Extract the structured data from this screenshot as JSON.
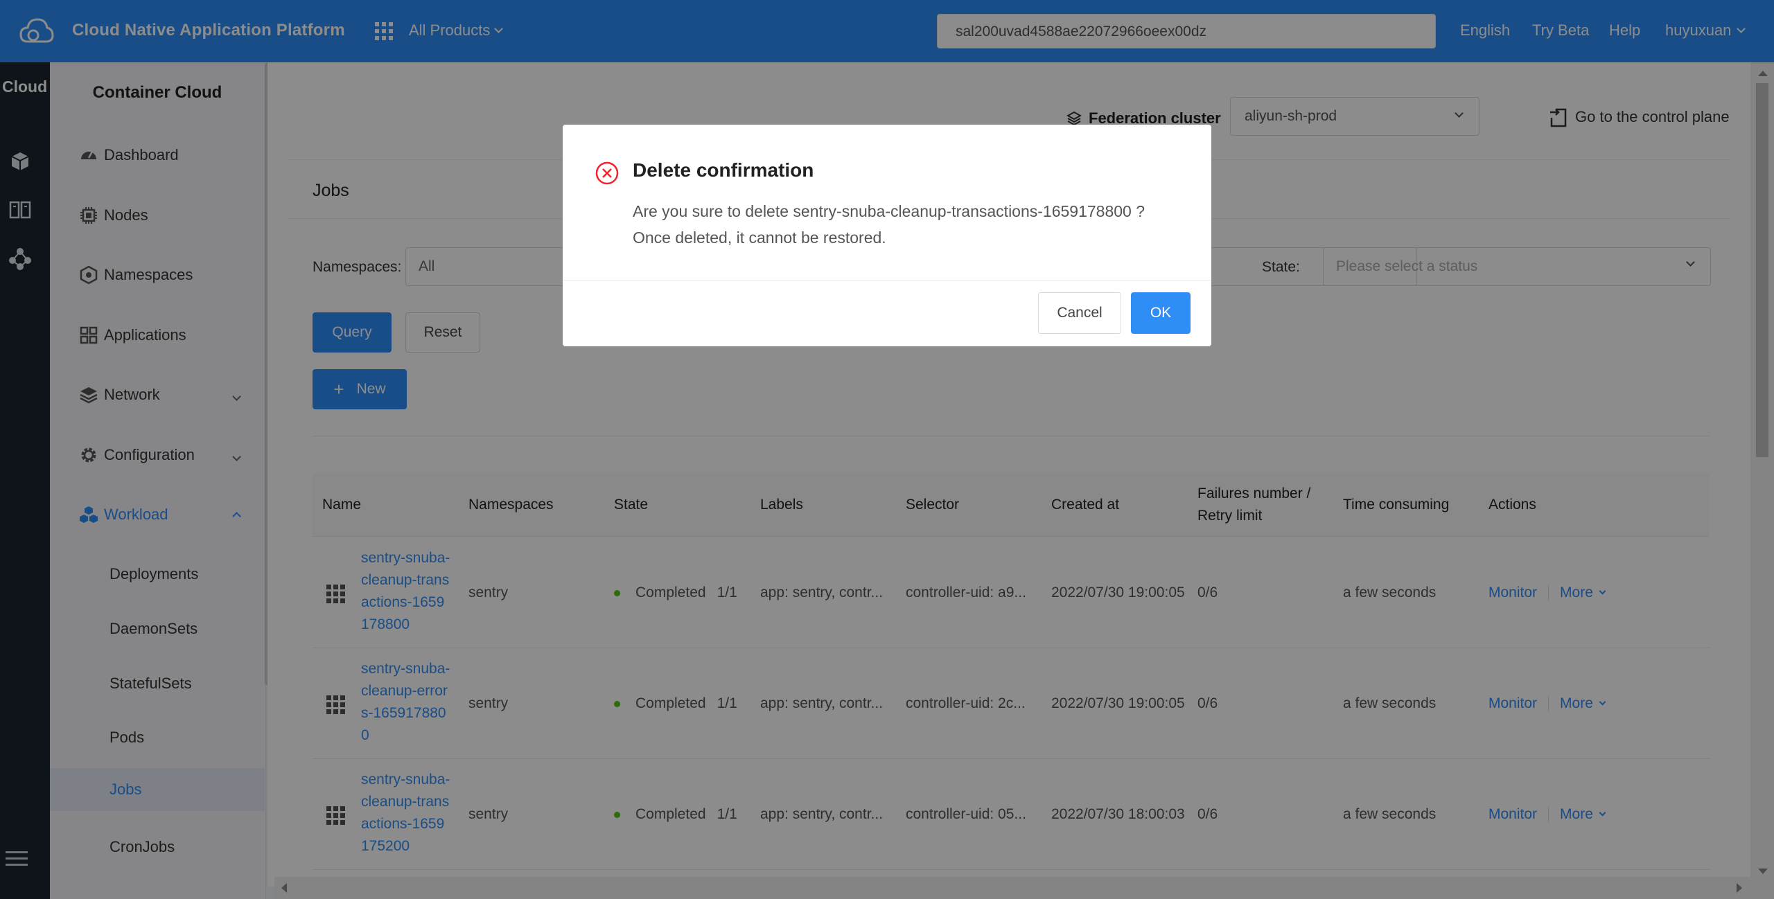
{
  "topbar": {
    "app_title": "Cloud Native Application Platform",
    "products_label": "All Products",
    "search_value": "sal200uvad4588ae22072966oeex00dz",
    "language": "English",
    "try_beta": "Try Beta",
    "help": "Help",
    "user": "huyuxuan",
    "bar_color": "#2f8df6"
  },
  "rail": {
    "title": "Cloud",
    "icons": [
      "cube-icon",
      "book-icon",
      "cluster-icon",
      "menu-icon"
    ]
  },
  "sidebar": {
    "header": "Container Cloud",
    "items": [
      {
        "label": "Dashboard",
        "icon": "dashboard-icon"
      },
      {
        "label": "Nodes",
        "icon": "chip-icon"
      },
      {
        "label": "Namespaces",
        "icon": "hexagon-icon"
      },
      {
        "label": "Applications",
        "icon": "apps-icon"
      },
      {
        "label": "Network",
        "icon": "layers-icon"
      },
      {
        "label": "Configuration",
        "icon": "gear-icon"
      },
      {
        "label": "Workload",
        "icon": "cubes-icon"
      }
    ],
    "workload_children": [
      "Deployments",
      "DaemonSets",
      "StatefulSets",
      "Pods",
      "Jobs",
      "CronJobs"
    ],
    "active_item": "Jobs"
  },
  "cluster": {
    "label": "Federation cluster",
    "selected": "aliyun-sh-prod",
    "control_plane": "Go to the control plane"
  },
  "jobs": {
    "title": "Jobs",
    "filters": {
      "namespaces_label": "Namespaces",
      "namespaces_value": "All",
      "state_label": "State",
      "state_placeholder": "Please select a status",
      "colon": ":"
    },
    "buttons": {
      "query": "Query",
      "reset": "Reset",
      "new": "New",
      "plus": "+"
    },
    "columns": [
      "Name",
      "Namespaces",
      "State",
      "Labels",
      "Selector",
      "Created at",
      "Failures number / Retry limit",
      "Time consuming",
      "Actions"
    ],
    "rows": [
      {
        "name": "sentry-snuba-cleanup-transactions-1659178800",
        "namespace": "sentry",
        "state": "Completed",
        "count": "1/1",
        "labels": "app: sentry, contr...",
        "selector": "controller-uid: a9...",
        "created": "2022/07/30 19:00:05",
        "failures": "0/6",
        "time": "a few seconds",
        "monitor": "Monitor",
        "more": "More"
      },
      {
        "name": "sentry-snuba-cleanup-errors-1659178800",
        "namespace": "sentry",
        "state": "Completed",
        "count": "1/1",
        "labels": "app: sentry, contr...",
        "selector": "controller-uid: 2c...",
        "created": "2022/07/30 19:00:05",
        "failures": "0/6",
        "time": "a few seconds",
        "monitor": "Monitor",
        "more": "More"
      },
      {
        "name": "sentry-snuba-cleanup-transactions-1659175200",
        "namespace": "sentry",
        "state": "Completed",
        "count": "1/1",
        "labels": "app: sentry, contr...",
        "selector": "controller-uid: 05...",
        "created": "2022/07/30 18:00:03",
        "failures": "0/6",
        "time": "a few seconds",
        "monitor": "Monitor",
        "more": "More"
      }
    ]
  },
  "modal": {
    "title": "Delete confirmation",
    "body": "Are you sure to delete sentry-snuba-cleanup-transactions-1659178800 ? Once deleted, it cannot be restored.",
    "cancel": "Cancel",
    "ok": "OK",
    "error_color": "#f5222d"
  }
}
